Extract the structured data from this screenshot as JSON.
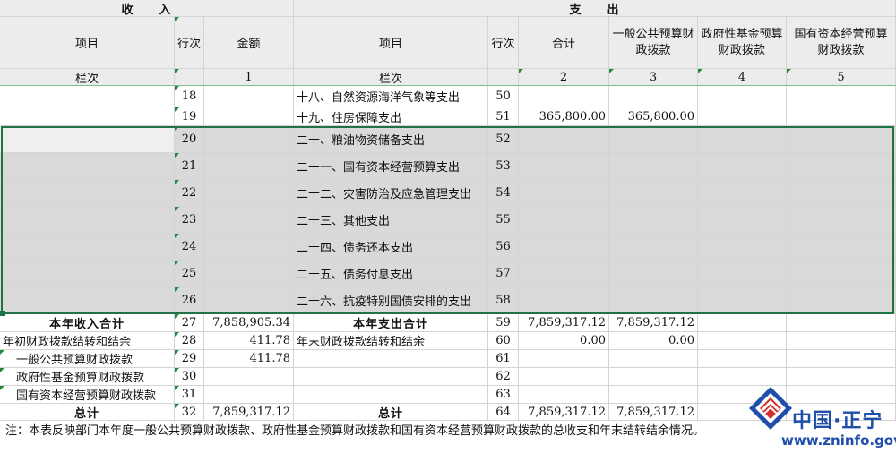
{
  "header": {
    "income": "收　　入",
    "expense": "支　　出",
    "item": "项目",
    "row_no": "行次",
    "amount": "金额",
    "total": "合计",
    "general": "一般公共预算财政拨款",
    "fund": "政府性基金预算财政拨款",
    "state": "国有资本经营预算财政拨款",
    "col_label": "栏次",
    "col_1": "1",
    "col_2": "2",
    "col_3": "3",
    "col_4": "4",
    "col_5": "5"
  },
  "rows": [
    {
      "lno": "18",
      "exp": "十八、自然资源海洋气象等支出",
      "eno": "50"
    },
    {
      "lno": "19",
      "exp": "十九、住房保障支出",
      "eno": "51",
      "total": "365,800.00",
      "general": "365,800.00"
    },
    {
      "lno": "20",
      "exp": "二十、粮油物资储备支出",
      "eno": "52"
    },
    {
      "lno": "21",
      "exp": "二十一、国有资本经营预算支出",
      "eno": "53"
    },
    {
      "lno": "22",
      "exp": "二十二、灾害防治及应急管理支出",
      "eno": "54"
    },
    {
      "lno": "23",
      "exp": "二十三、其他支出",
      "eno": "55"
    },
    {
      "lno": "24",
      "exp": "二十四、债务还本支出",
      "eno": "56"
    },
    {
      "lno": "25",
      "exp": "二十五、债务付息支出",
      "eno": "57"
    },
    {
      "lno": "26",
      "exp": "二十六、抗疫特别国债安排的支出",
      "eno": "58"
    }
  ],
  "summary": [
    {
      "inc": "本年收入合计",
      "lno": "27",
      "amt": "7,858,905.34",
      "exp": "本年支出合计",
      "eno": "59",
      "total": "7,859,317.12",
      "general": "7,859,317.12"
    },
    {
      "inc": "年初财政拨款结转和结余",
      "lno": "28",
      "amt": "411.78",
      "exp": "年末财政拨款结转和结余",
      "eno": "60",
      "total": "0.00",
      "general": "0.00"
    },
    {
      "inc": "一般公共预算财政拨款",
      "lno": "29",
      "amt": "411.78",
      "exp": "",
      "eno": "61",
      "total": "",
      "general": ""
    },
    {
      "inc": "政府性基金预算财政拨款",
      "lno": "30",
      "amt": "",
      "exp": "",
      "eno": "62",
      "total": "",
      "general": ""
    },
    {
      "inc": "国有资本经营预算财政拨款",
      "lno": "31",
      "amt": "",
      "exp": "",
      "eno": "63",
      "total": "",
      "general": ""
    },
    {
      "inc": "总计",
      "lno": "32",
      "amt": "7,859,317.12",
      "exp": "总计",
      "eno": "64",
      "total": "7,859,317.12",
      "general": "7,859,317.12"
    }
  ],
  "note": "注：本表反映部门本年度一般公共预算财政拨款、政府性基金预算财政拨款和国有资本经营预算财政拨款的总收支和年末结转结余情况。",
  "watermark": {
    "name": "中国·正宁",
    "url": "www.zninfo.gov.cn"
  }
}
